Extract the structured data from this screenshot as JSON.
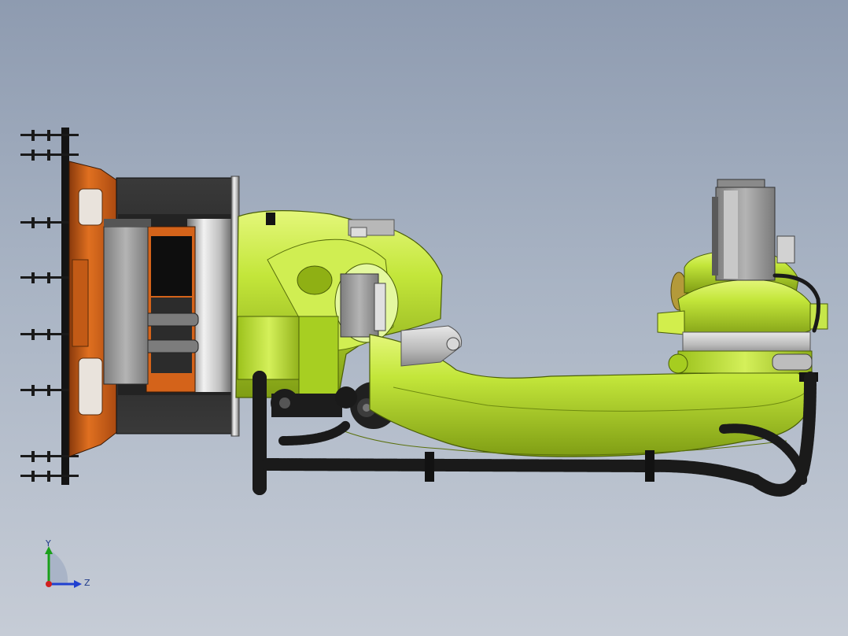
{
  "viewport": {
    "background_top": "#8e9bb0",
    "background_bottom": "#c6ccd6"
  },
  "model": {
    "colors": {
      "body_green": "#b4dc2a",
      "body_green_light": "#d6f060",
      "body_green_dark": "#7a9a12",
      "flange_orange": "#d4631a",
      "motor_grey": "#9a9a9a",
      "housing_black": "#1e1e1e",
      "cable_black": "#151515"
    }
  },
  "triad": {
    "y_label": "Y",
    "z_label": "Z",
    "icon": "coordinate-triad-icon",
    "y_color": "#1aa01a",
    "z_color": "#2040d0",
    "x_color": "#d02020"
  }
}
